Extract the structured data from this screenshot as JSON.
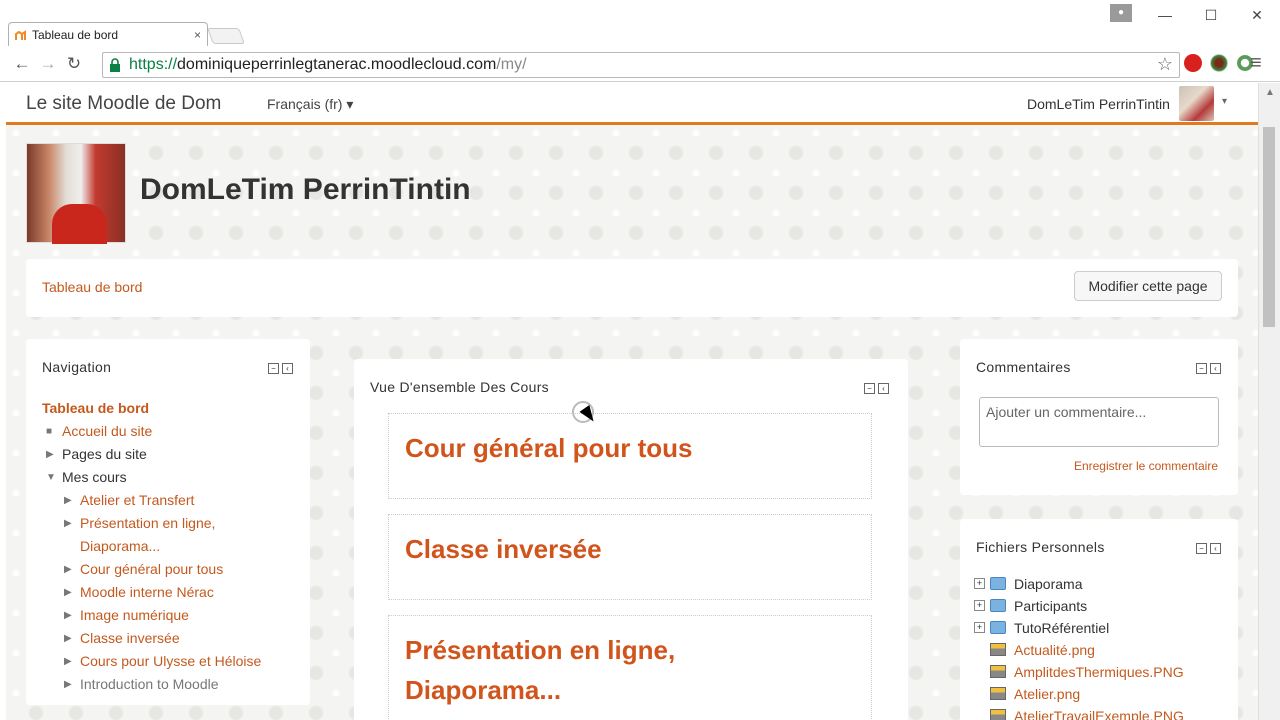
{
  "browser": {
    "tab_title": "Tableau de bord",
    "tab_close": "×",
    "url_scheme": "https://",
    "url_host": "dominiqueperrinlegtanerac.moodlecloud.com",
    "url_path": "/my/",
    "win_minimize": "—",
    "win_maximize": "☐",
    "win_close": "✕",
    "back": "←",
    "forward": "→",
    "reload": "↻",
    "star": "☆",
    "menu": "≡"
  },
  "navbar": {
    "site_name": "Le site Moodle de Dom",
    "language": "Français (fr) ▾",
    "user_name": "DomLeTim PerrinTintin",
    "caret": "▾"
  },
  "header": {
    "profile_name": "DomLeTim PerrinTintin"
  },
  "page_header": {
    "breadcrumb": "Tableau de bord",
    "edit_button": "Modifier cette page"
  },
  "navigation": {
    "title": "Navigation",
    "items": [
      {
        "label": "Tableau de bord",
        "style": "bold-orange",
        "indent": 0,
        "bullet": ""
      },
      {
        "label": "Accueil du site",
        "style": "orange",
        "indent": 1,
        "bullet": "■"
      },
      {
        "label": "Pages du site",
        "style": "dark",
        "indent": 1,
        "bullet": "▶"
      },
      {
        "label": "Mes cours",
        "style": "dark",
        "indent": 1,
        "bullet": "▼"
      },
      {
        "label": "Atelier et Transfert",
        "style": "orange",
        "indent": 2,
        "bullet": "▶"
      },
      {
        "label": "Présentation en ligne,",
        "style": "orange",
        "indent": 2,
        "bullet": "▶"
      },
      {
        "label": "Diaporama...",
        "style": "orange",
        "indent": 2,
        "bullet": ""
      },
      {
        "label": "Cour général pour tous",
        "style": "orange",
        "indent": 2,
        "bullet": "▶"
      },
      {
        "label": "Moodle interne Nérac",
        "style": "orange",
        "indent": 2,
        "bullet": "▶"
      },
      {
        "label": "Image numérique",
        "style": "orange",
        "indent": 2,
        "bullet": "▶"
      },
      {
        "label": "Classe inversée",
        "style": "orange",
        "indent": 2,
        "bullet": "▶"
      },
      {
        "label": "Cours pour Ulysse et Héloise",
        "style": "orange",
        "indent": 2,
        "bullet": "▶"
      },
      {
        "label": "Introduction to Moodle",
        "style": "grey",
        "indent": 2,
        "bullet": "▶"
      }
    ]
  },
  "courses": {
    "title": "Vue D'ensemble Des Cours",
    "cards": [
      {
        "line1": "Cour général pour tous",
        "line2": ""
      },
      {
        "line1": "Classe inversée",
        "line2": ""
      },
      {
        "line1": "Présentation en ligne,",
        "line2": "Diaporama..."
      }
    ]
  },
  "comments": {
    "title": "Commentaires",
    "placeholder": "Ajouter un commentaire...",
    "save_link": "Enregistrer le commentaire"
  },
  "files": {
    "title": "Fichiers Personnels",
    "items": [
      {
        "name": "Diaporama",
        "type": "folder"
      },
      {
        "name": "Participants",
        "type": "folder"
      },
      {
        "name": "TutoRéférentiel",
        "type": "folder"
      },
      {
        "name": "Actualité.png",
        "type": "file"
      },
      {
        "name": "AmplitdesThermiques.PNG",
        "type": "file"
      },
      {
        "name": "Atelier.png",
        "type": "file"
      },
      {
        "name": "AtelierTravailExemple.PNG",
        "type": "file"
      }
    ]
  },
  "block_controls": {
    "collapse": "−",
    "dock": "‹"
  },
  "colors": {
    "accent": "#e07a1f",
    "link": "#c4591e",
    "course_title": "#d1541c"
  }
}
